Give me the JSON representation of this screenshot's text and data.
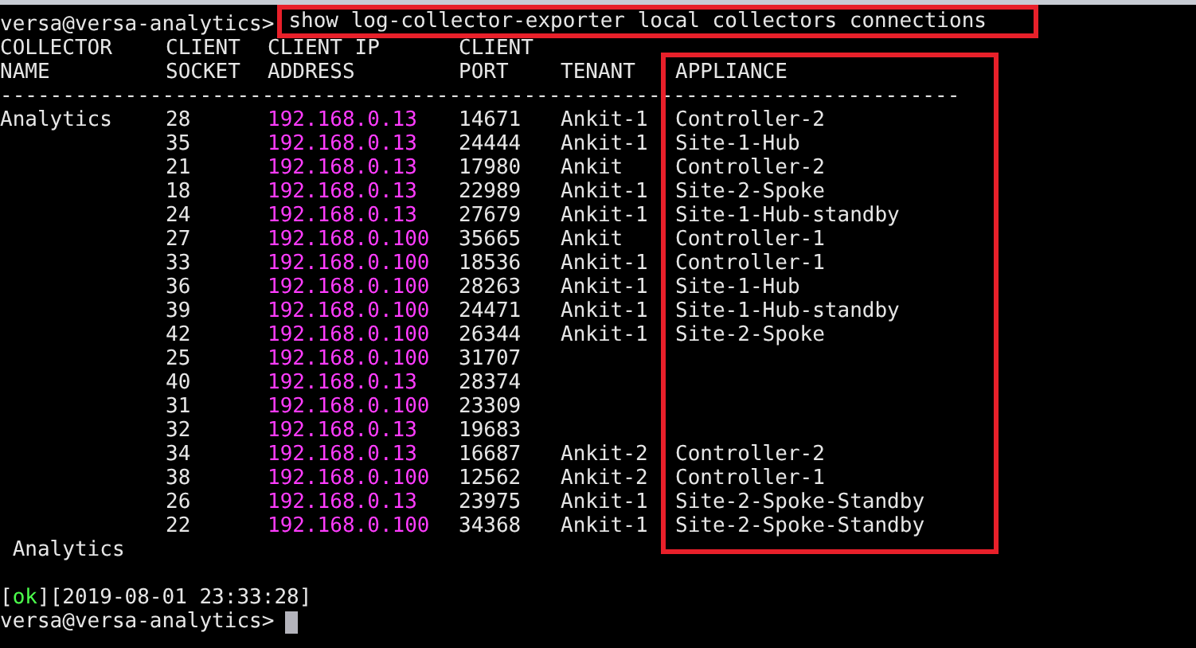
{
  "prompt": "versa@versa-analytics>",
  "command": "show log-collector-exporter local collectors connections",
  "columns": [
    {
      "line1": "COLLECTOR",
      "line2": "NAME"
    },
    {
      "line1": "CLIENT",
      "line2": "SOCKET"
    },
    {
      "line1": "CLIENT IP",
      "line2": "ADDRESS"
    },
    {
      "line1": "CLIENT",
      "line2": "PORT"
    },
    {
      "line2": "TENANT"
    },
    {
      "line2": "APPLIANCE"
    }
  ],
  "rule": "-----------------------------------------------------------------------------",
  "rows": [
    {
      "collector": "Analytics",
      "socket": "28",
      "ip": "192.168.0.13",
      "port": "14671",
      "tenant": "Ankit-1",
      "appliance": "Controller-2"
    },
    {
      "socket": "35",
      "ip": "192.168.0.13",
      "port": "24444",
      "tenant": "Ankit-1",
      "appliance": "Site-1-Hub"
    },
    {
      "socket": "21",
      "ip": "192.168.0.13",
      "port": "17980",
      "tenant": "Ankit",
      "appliance": "Controller-2"
    },
    {
      "socket": "18",
      "ip": "192.168.0.13",
      "port": "22989",
      "tenant": "Ankit-1",
      "appliance": "Site-2-Spoke"
    },
    {
      "socket": "24",
      "ip": "192.168.0.13",
      "port": "27679",
      "tenant": "Ankit-1",
      "appliance": "Site-1-Hub-standby"
    },
    {
      "socket": "27",
      "ip": "192.168.0.100",
      "port": "35665",
      "tenant": "Ankit",
      "appliance": "Controller-1"
    },
    {
      "socket": "33",
      "ip": "192.168.0.100",
      "port": "18536",
      "tenant": "Ankit-1",
      "appliance": "Controller-1"
    },
    {
      "socket": "36",
      "ip": "192.168.0.100",
      "port": "28263",
      "tenant": "Ankit-1",
      "appliance": "Site-1-Hub"
    },
    {
      "socket": "39",
      "ip": "192.168.0.100",
      "port": "24471",
      "tenant": "Ankit-1",
      "appliance": "Site-1-Hub-standby"
    },
    {
      "socket": "42",
      "ip": "192.168.0.100",
      "port": "26344",
      "tenant": "Ankit-1",
      "appliance": "Site-2-Spoke"
    },
    {
      "socket": "25",
      "ip": "192.168.0.100",
      "port": "31707"
    },
    {
      "socket": "40",
      "ip": "192.168.0.13",
      "port": "28374"
    },
    {
      "socket": "31",
      "ip": "192.168.0.100",
      "port": "23309"
    },
    {
      "socket": "32",
      "ip": "192.168.0.13",
      "port": "19683"
    },
    {
      "socket": "34",
      "ip": "192.168.0.13",
      "port": "16687",
      "tenant": "Ankit-2",
      "appliance": "Controller-2"
    },
    {
      "socket": "38",
      "ip": "192.168.0.100",
      "port": "12562",
      "tenant": "Ankit-2",
      "appliance": "Controller-1"
    },
    {
      "socket": "26",
      "ip": "192.168.0.13",
      "port": "23975",
      "tenant": "Ankit-1",
      "appliance": "Site-2-Spoke-Standby"
    },
    {
      "socket": "22",
      "ip": "192.168.0.100",
      "port": "34368",
      "tenant": "Ankit-1",
      "appliance": "Site-2-Spoke-Standby"
    }
  ],
  "footer": "Analytics",
  "status": {
    "ok": "ok",
    "bracket_open": "[",
    "bracket_close": "]",
    "timestamp": "[2019-08-01 23:33:28]"
  },
  "final_prompt": "versa@versa-analytics>"
}
